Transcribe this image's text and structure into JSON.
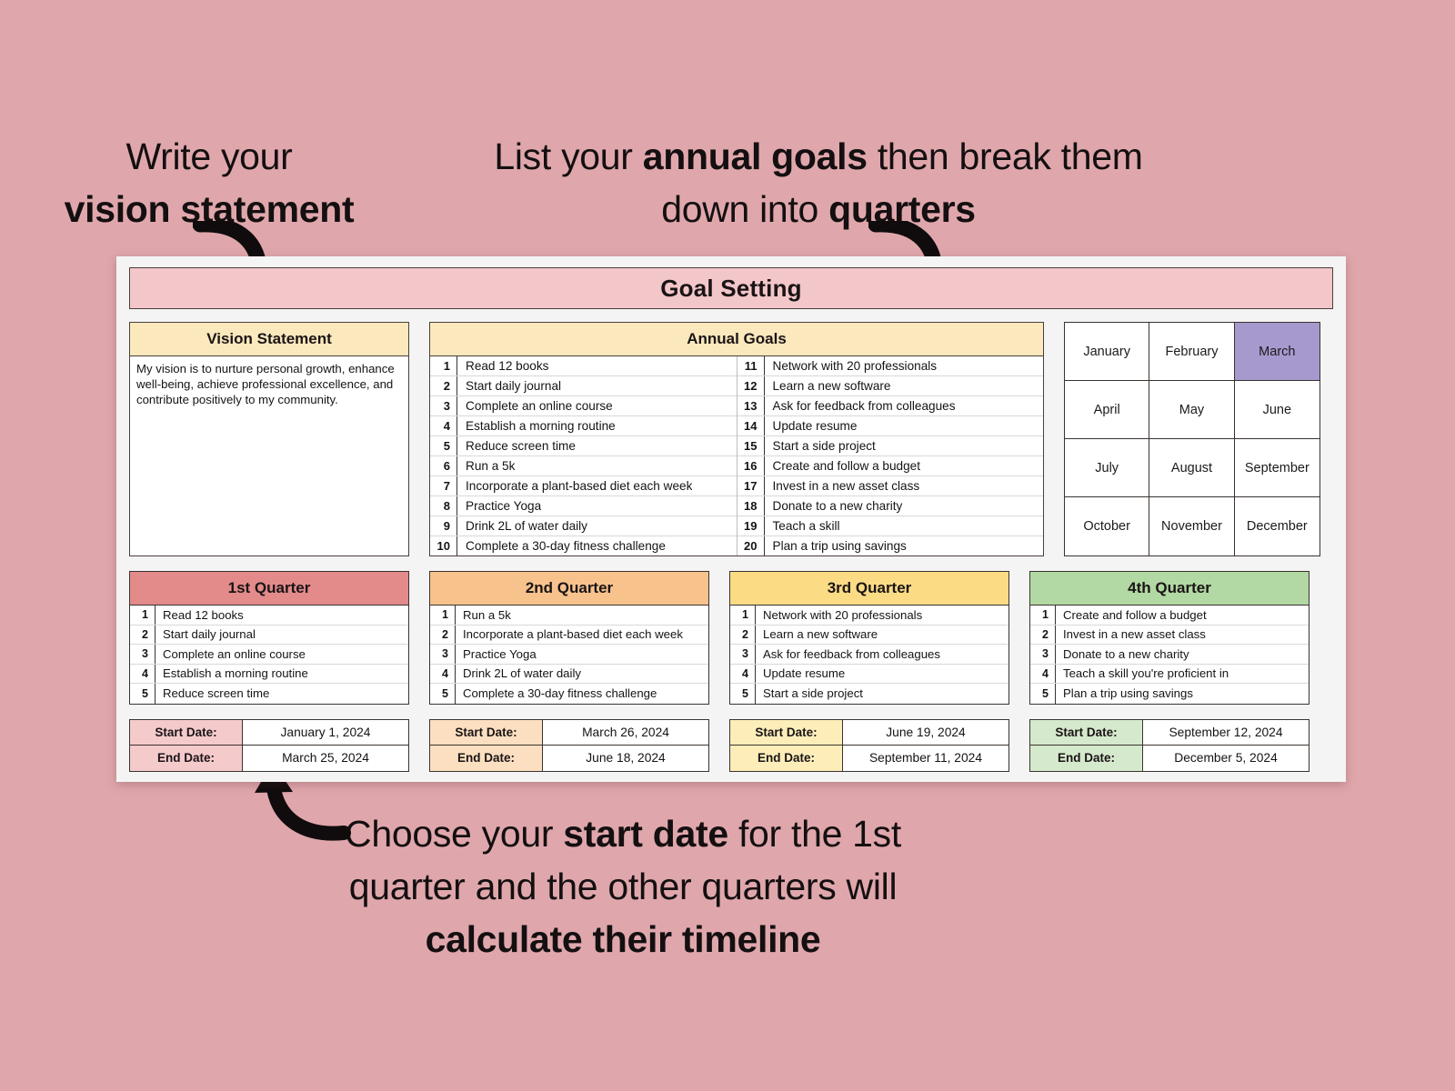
{
  "annotations": {
    "vision": {
      "line1": "Write your",
      "line2": "vision statement"
    },
    "goals": {
      "l1a": "List your ",
      "l1b": "annual goals",
      "l1c": " then break them",
      "l2a": "down into ",
      "l2b": "quarters"
    },
    "start": {
      "l1a": "Choose your ",
      "l1b": "start date",
      "l1c": " for the 1st",
      "l2": "quarter and the other quarters will",
      "l3": "calculate their timeline"
    }
  },
  "banner": {
    "title": "Goal Setting"
  },
  "vision": {
    "header": "Vision Statement",
    "body": "My vision is to nurture personal growth, enhance well-being, achieve professional excellence, and contribute positively to my community."
  },
  "annual_goals": {
    "header": "Annual Goals",
    "left": [
      {
        "n": "1",
        "text": "Read 12 books"
      },
      {
        "n": "2",
        "text": "Start daily journal"
      },
      {
        "n": "3",
        "text": "Complete an online course"
      },
      {
        "n": "4",
        "text": "Establish a morning routine"
      },
      {
        "n": "5",
        "text": "Reduce screen time"
      },
      {
        "n": "6",
        "text": "Run a 5k"
      },
      {
        "n": "7",
        "text": "Incorporate a plant-based diet each week"
      },
      {
        "n": "8",
        "text": "Practice Yoga"
      },
      {
        "n": "9",
        "text": "Drink 2L of water daily"
      },
      {
        "n": "10",
        "text": "Complete a 30-day fitness challenge"
      }
    ],
    "right": [
      {
        "n": "11",
        "text": "Network with 20 professionals"
      },
      {
        "n": "12",
        "text": "Learn a new software"
      },
      {
        "n": "13",
        "text": "Ask for feedback from colleagues"
      },
      {
        "n": "14",
        "text": "Update resume"
      },
      {
        "n": "15",
        "text": "Start a side project"
      },
      {
        "n": "16",
        "text": "Create and follow a budget"
      },
      {
        "n": "17",
        "text": "Invest in a new asset class"
      },
      {
        "n": "18",
        "text": "Donate to a new charity"
      },
      {
        "n": "19",
        "text": "Teach a skill"
      },
      {
        "n": "20",
        "text": "Plan a trip using savings"
      }
    ]
  },
  "months": {
    "cells": [
      {
        "name": "January",
        "active": false
      },
      {
        "name": "February",
        "active": false
      },
      {
        "name": "March",
        "active": true
      },
      {
        "name": "April",
        "active": false
      },
      {
        "name": "May",
        "active": false
      },
      {
        "name": "June",
        "active": false
      },
      {
        "name": "July",
        "active": false
      },
      {
        "name": "August",
        "active": false
      },
      {
        "name": "September",
        "active": false
      },
      {
        "name": "October",
        "active": false
      },
      {
        "name": "November",
        "active": false
      },
      {
        "name": "December",
        "active": false
      }
    ],
    "active_color": "#a699ce"
  },
  "quarters": [
    {
      "title": "1st Quarter",
      "header_color": "#e38a8a",
      "label_color": "#f5cacb",
      "items": [
        {
          "n": "1",
          "text": "Read 12 books"
        },
        {
          "n": "2",
          "text": "Start daily journal"
        },
        {
          "n": "3",
          "text": "Complete an online course"
        },
        {
          "n": "4",
          "text": "Establish a morning routine"
        },
        {
          "n": "5",
          "text": "Reduce screen time"
        }
      ],
      "start_label": "Start Date:",
      "start_value": "January 1, 2024",
      "end_label": "End Date:",
      "end_value": "March 25, 2024"
    },
    {
      "title": "2nd Quarter",
      "header_color": "#f7c28c",
      "label_color": "#fbdfc0",
      "items": [
        {
          "n": "1",
          "text": "Run a 5k"
        },
        {
          "n": "2",
          "text": "Incorporate a plant-based diet each week"
        },
        {
          "n": "3",
          "text": "Practice Yoga"
        },
        {
          "n": "4",
          "text": "Drink 2L of water daily"
        },
        {
          "n": "5",
          "text": "Complete a 30-day fitness challenge"
        }
      ],
      "start_label": "Start Date:",
      "start_value": "March 26, 2024",
      "end_label": "End Date:",
      "end_value": "June 18, 2024"
    },
    {
      "title": "3rd Quarter",
      "header_color": "#fbdc85",
      "label_color": "#fdeeb9",
      "items": [
        {
          "n": "1",
          "text": "Network with 20 professionals"
        },
        {
          "n": "2",
          "text": "Learn a new software"
        },
        {
          "n": "3",
          "text": "Ask for feedback from colleagues"
        },
        {
          "n": "4",
          "text": "Update resume"
        },
        {
          "n": "5",
          "text": "Start a side project"
        }
      ],
      "start_label": "Start Date:",
      "start_value": "June 19, 2024",
      "end_label": "End Date:",
      "end_value": "September 11, 2024"
    },
    {
      "title": "4th Quarter",
      "header_color": "#b2d8a3",
      "label_color": "#d5e9cc",
      "items": [
        {
          "n": "1",
          "text": "Create and follow a budget"
        },
        {
          "n": "2",
          "text": "Invest in a new asset class"
        },
        {
          "n": "3",
          "text": "Donate to a new charity"
        },
        {
          "n": "4",
          "text": "Teach a skill you're proficient in"
        },
        {
          "n": "5",
          "text": "Plan a trip using savings"
        }
      ],
      "start_label": "Start Date:",
      "start_value": "September 12, 2024",
      "end_label": "End Date:",
      "end_value": "December 5, 2024"
    }
  ],
  "theme": {
    "background": "#dfa7ac",
    "banner": "#f3c6ca",
    "panel_header": "#fbe8bc",
    "card": "#f4f4f4"
  }
}
